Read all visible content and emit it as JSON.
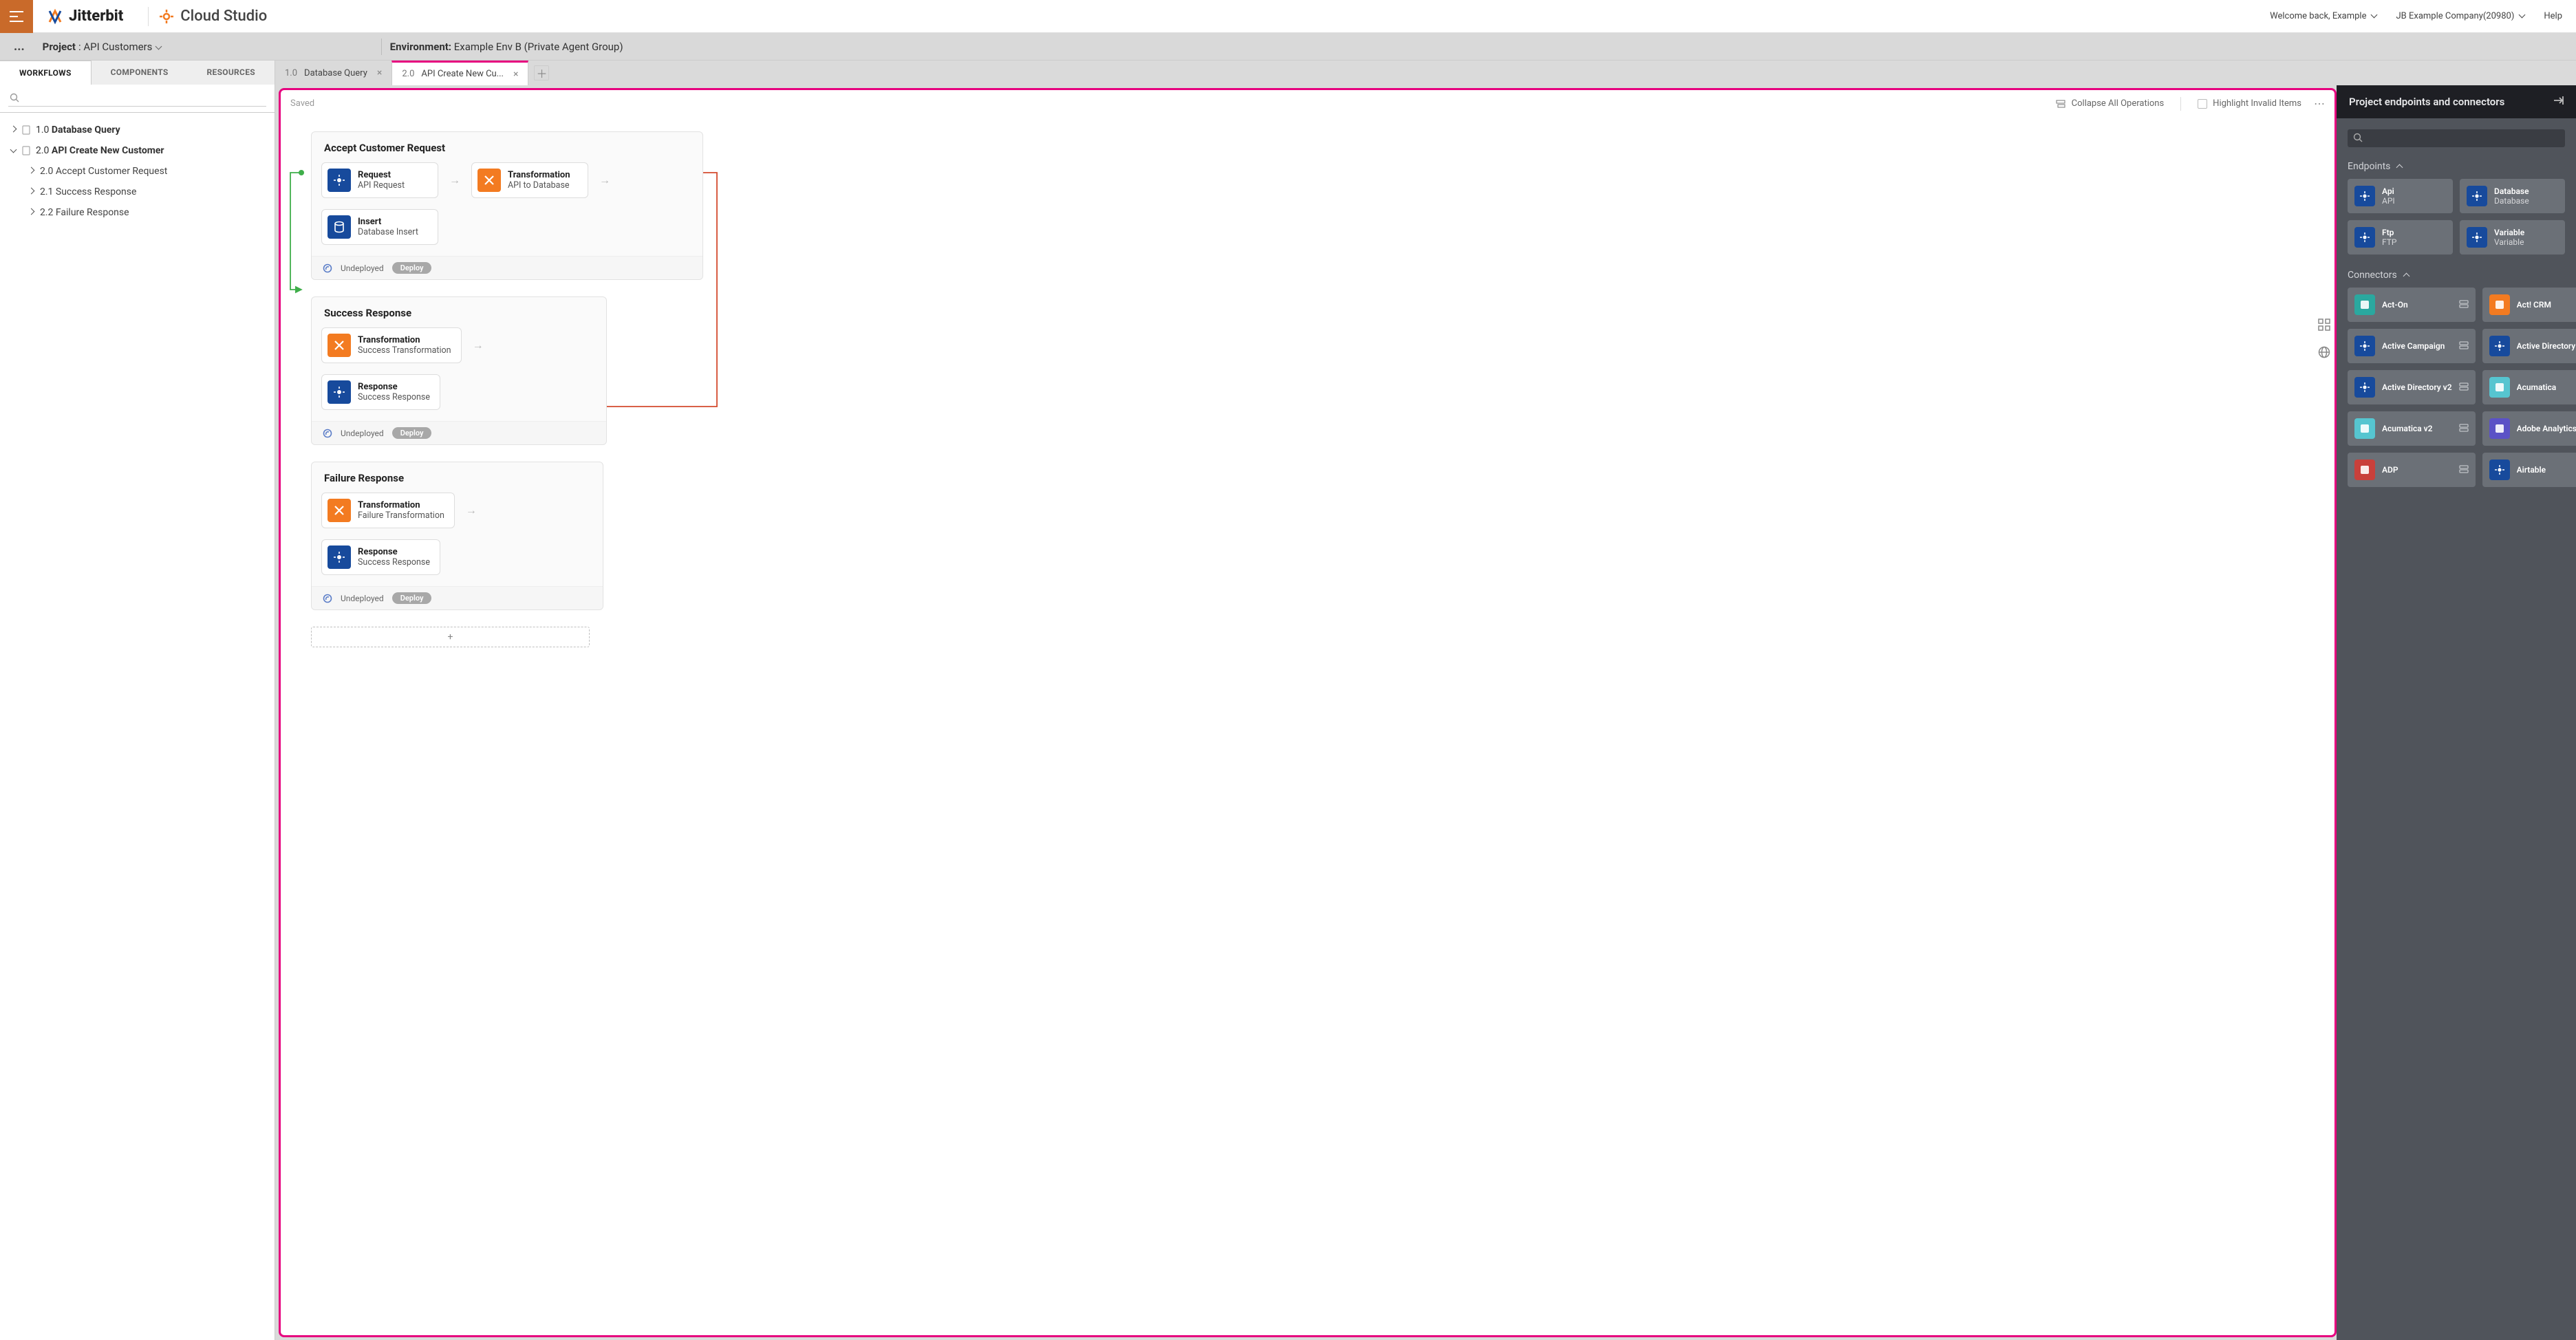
{
  "header": {
    "brand": "Jitterbit",
    "studio": "Cloud Studio",
    "welcome": "Welcome back, Example",
    "company": "JB Example Company(20980)",
    "help": "Help"
  },
  "context": {
    "project_label": "Project",
    "project_name": ": API Customers",
    "env_label": "Environment:",
    "env_name": " Example Env B (Private Agent Group)"
  },
  "left_tabs": {
    "workflows": "WORKFLOWS",
    "components": "COMPONENTS",
    "resources": "RESOURCES"
  },
  "workflow_tabs": {
    "t1_num": "1.0",
    "t1_label": " Database Query",
    "t2_num": "2.0",
    "t2_label": " API Create New Cu...",
    "add": "＋"
  },
  "tree": {
    "r1_prefix": "1.0 ",
    "r1_bold": "Database Query",
    "r2_prefix": "2.0 ",
    "r2_bold": "API Create New Customer",
    "c1": "2.0 Accept Customer Request",
    "c2": "2.1 Success Response",
    "c3": "2.2 Failure Response"
  },
  "canvas": {
    "saved": "Saved",
    "collapse": "Collapse All Operations",
    "highlight": "Highlight Invalid Items",
    "more": "⋯",
    "undeployed": "Undeployed",
    "deploy": "Deploy",
    "add_op": "+",
    "ops": [
      {
        "title": "Accept Customer Request",
        "steps": [
          {
            "icon": "blue",
            "h": "Request",
            "s": "API Request"
          },
          {
            "icon": "orange",
            "h": "Transformation",
            "s": "API to Database"
          },
          {
            "icon": "blue",
            "h": "Insert",
            "s": "Database Insert"
          }
        ]
      },
      {
        "title": "Success Response",
        "steps": [
          {
            "icon": "orange",
            "h": "Transformation",
            "s": "Success Transformation"
          },
          {
            "icon": "blue",
            "h": "Response",
            "s": "Success Response"
          }
        ]
      },
      {
        "title": "Failure Response",
        "steps": [
          {
            "icon": "orange",
            "h": "Transformation",
            "s": "Failure Transformation"
          },
          {
            "icon": "blue",
            "h": "Response",
            "s": "Success Response"
          }
        ]
      }
    ]
  },
  "palette": {
    "title": "Project endpoints and connectors",
    "endpoints_h": "Endpoints",
    "connectors_h": "Connectors",
    "endpoints": [
      {
        "a": "Api",
        "b": "API",
        "ic": "blue"
      },
      {
        "a": "Database",
        "b": "Database",
        "ic": "blue"
      },
      {
        "a": "Ftp",
        "b": "FTP",
        "ic": "blue"
      },
      {
        "a": "Variable",
        "b": "Variable",
        "ic": "blue"
      }
    ],
    "connectors": [
      {
        "a": "Act-On",
        "ic": "teal"
      },
      {
        "a": "Act! CRM",
        "ic": "orange"
      },
      {
        "a": "Active Campaign",
        "ic": "blue"
      },
      {
        "a": "Active Directory",
        "ic": "blue"
      },
      {
        "a": "Active Directory v2",
        "ic": "blue"
      },
      {
        "a": "Acumatica",
        "ic": "cyan"
      },
      {
        "a": "Acumatica v2",
        "ic": "cyan"
      },
      {
        "a": "Adobe Analytics",
        "ic": "indigo"
      },
      {
        "a": "ADP",
        "ic": "red"
      },
      {
        "a": "Airtable",
        "ic": "blue"
      }
    ]
  }
}
